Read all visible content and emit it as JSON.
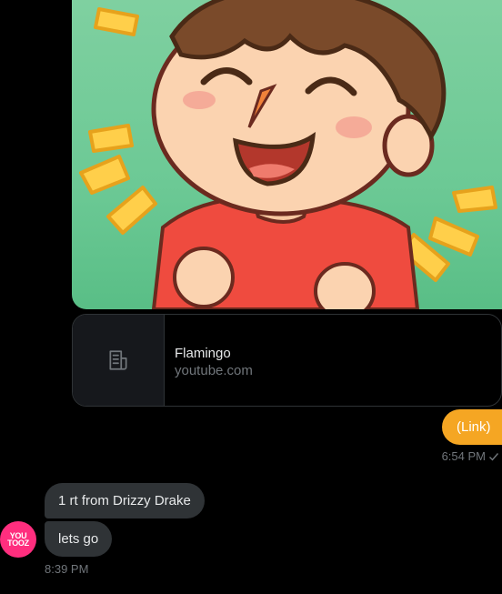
{
  "media": {
    "alt_icon": "cartoon-boy-image"
  },
  "link_preview": {
    "title": "Flamingo",
    "domain": "youtube.com"
  },
  "sent": {
    "text": "(Link)",
    "time": "6:54 PM",
    "status_icon": "check-icon"
  },
  "received": {
    "messages": [
      "1 rt from Drizzy Drake",
      "lets go"
    ],
    "time": "8:39 PM",
    "avatar": {
      "line1": "YOU",
      "line2": "TOOZ"
    }
  },
  "colors": {
    "sent_bubble": "#f5a623",
    "recv_bubble": "#2f3336",
    "avatar": "#ff2e7e"
  }
}
